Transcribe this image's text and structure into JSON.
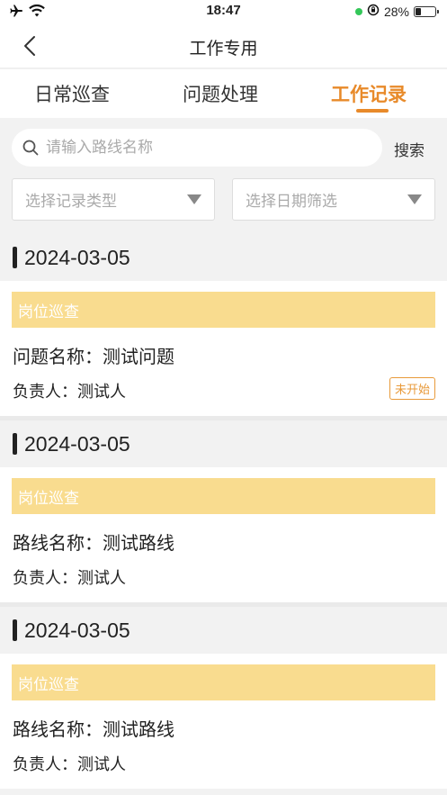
{
  "status_bar": {
    "time": "18:47",
    "battery_text": "28%",
    "battery_level": 0.28
  },
  "nav": {
    "title": "工作专用"
  },
  "tabs": [
    {
      "label": "日常巡查",
      "active": false
    },
    {
      "label": "问题处理",
      "active": false
    },
    {
      "label": "工作记录",
      "active": true
    }
  ],
  "search": {
    "placeholder": "请输入路线名称",
    "button_label": "搜索"
  },
  "filters": {
    "type_placeholder": "选择记录类型",
    "date_placeholder": "选择日期筛选"
  },
  "records": [
    {
      "date": "2024-03-05",
      "category": "岗位巡查",
      "line1": "问题名称：测试问题",
      "line2": "负责人：测试人",
      "status": "未开始"
    },
    {
      "date": "2024-03-05",
      "category": "岗位巡查",
      "line1": "路线名称：测试路线",
      "line2": "负责人：测试人",
      "status": ""
    },
    {
      "date": "2024-03-05",
      "category": "岗位巡查",
      "line1": "路线名称：测试路线",
      "line2": "负责人：测试人",
      "status": ""
    }
  ],
  "colors": {
    "accent": "#e88a2a",
    "banner": "#f9dc8f",
    "background": "#f2f2f2"
  }
}
